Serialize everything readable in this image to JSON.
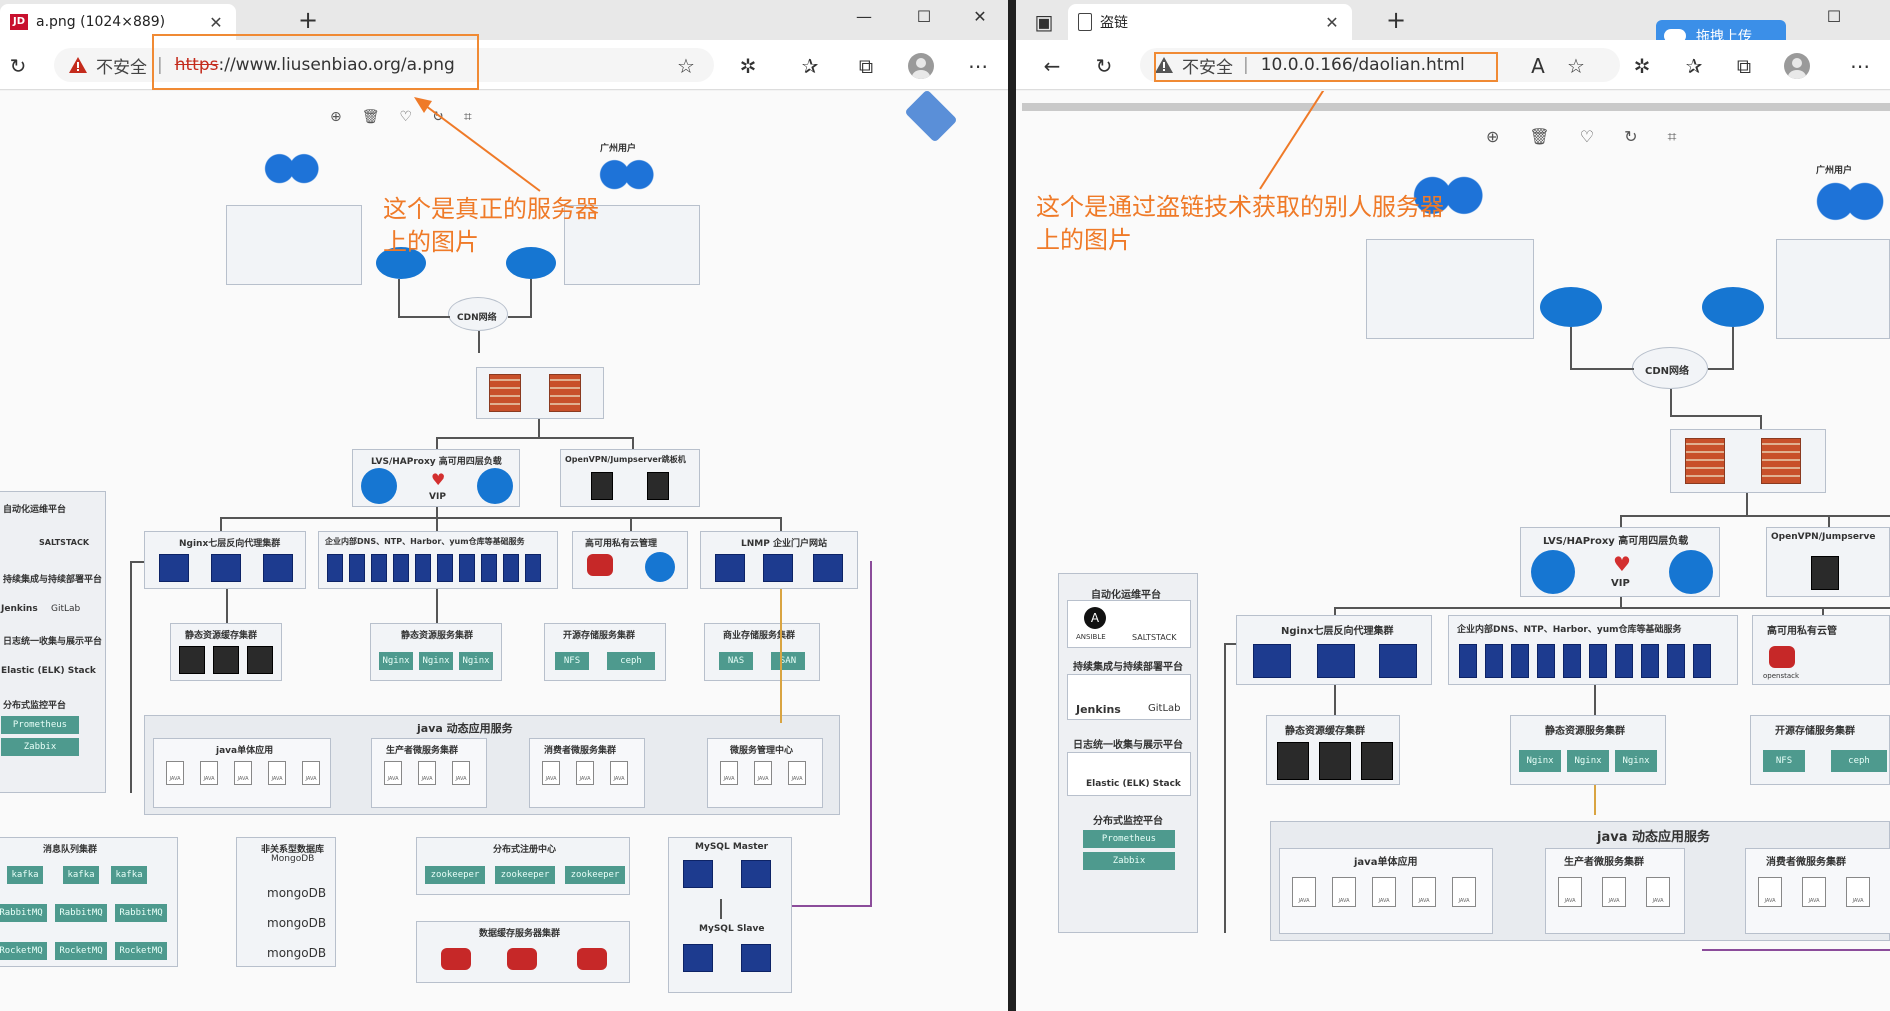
{
  "left_window": {
    "tab_title": "a.png (1024×889)",
    "favicon_text": "JD",
    "security_label": "不安全",
    "url_scheme": "https",
    "url_rest": "://www.liusenbiao.org/a.png",
    "annotation": "这个是真正的服务器上的图片",
    "annotation_line1": "这个是真正的服务器",
    "annotation_line2": "上的图片"
  },
  "right_window": {
    "tab_title": "盗链",
    "security_label": "不安全",
    "url": "10.0.0.166/daolian.html",
    "upload_badge": "拖拽上传",
    "annotation_line1": "这个是通过盗链技术获取的别人服务器",
    "annotation_line2": "上的图片"
  },
  "diagram": {
    "guangzhou_users": "广州用户",
    "cdn": "CDN网络",
    "lvs": "LVS/HAProxy 高可用四层负载",
    "vip": "VIP",
    "openvpn": "OpenVPN/Jumpserver跳板机",
    "openvpn_short": "OpenVPN/Jumpserve",
    "nginx_cluster": "Nginx七层反向代理集群",
    "infra": "企业内部DNS、NTP、Harbor、yum仓库等基础服务",
    "private_cloud": "高可用私有云管理",
    "private_cloud_short": "高可用私有云管",
    "lnmp": "LNMP 企业门户网站",
    "openstack": "openstack",
    "auto_ops": "自动化运维平台",
    "ansible": "ANSIBLE",
    "saltstack": "SALTSTACK",
    "ci_cd": "持续集成与持续部署平台",
    "jenkins": "Jenkins",
    "gitlab": "GitLab",
    "logging": "日志统一收集与展示平台",
    "elk": "Elastic (ELK) Stack",
    "monitor": "分布式监控平台",
    "prometheus": "Prometheus",
    "zabbix": "Zabbix",
    "static_cache": "静态资源缓存集群",
    "static_server": "静态资源服务集群",
    "nginx": "Nginx",
    "open_storage": "开源存储服务集群",
    "nfs": "NFS",
    "ceph": "ceph",
    "commercial_storage": "商业存储服务集群",
    "nas": "NAS",
    "san": "SAN",
    "java_services": "java 动态应用服务",
    "java_single": "java单体应用",
    "producer": "生产者微服务集群",
    "consumer": "消费者微服务集群",
    "ms_mgmt": "微服务管理中心",
    "mq": "消息队列集群",
    "kafka": "kafka",
    "rabbitmq": "RabbitMQ",
    "rocketmq": "RocketMQ",
    "nosql": "非关系型数据库",
    "mongodb_label": "MongoDB",
    "mongodb": "mongoDB",
    "registry": "分布式注册中心",
    "zookeeper": "zookeeper",
    "mysql_master": "MySQL Master",
    "mysql_slave": "MySQL Slave",
    "data_cache": "数据缓存服务器集群"
  },
  "colors": {
    "annotation": "#ef7a28",
    "insecure_red": "#c42b1c",
    "server_blue": "#1d3b8f",
    "chip_teal": "#4e9a8e"
  }
}
